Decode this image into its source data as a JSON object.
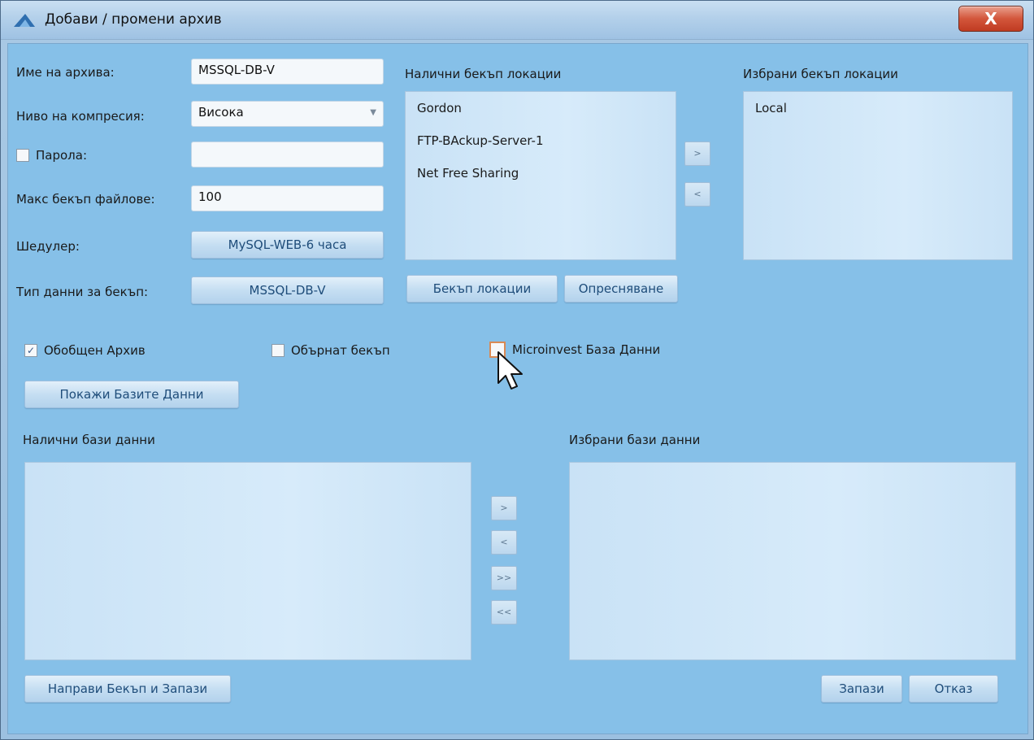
{
  "window": {
    "title": "Добави / промени архив",
    "close_label": "X"
  },
  "form": {
    "archive_name_label": "Име на архива:",
    "archive_name_value": "MSSQL-DB-V",
    "compression_label": "Ниво на компресия:",
    "compression_value": "Висока",
    "password_label": "Парола:",
    "password_value": "",
    "max_files_label": "Макс бекъп файлове:",
    "max_files_value": "100",
    "scheduler_label": "Шедулер:",
    "scheduler_button": "MySQL-WEB-6 часа",
    "data_type_label": "Тип данни за бекъп:",
    "data_type_button": "MSSQL-DB-V"
  },
  "locations": {
    "available_header": "Налични бекъп локации",
    "available": [
      "Gordon",
      "FTP-BAckup-Server-1",
      "Net Free Sharing"
    ],
    "selected_header": "Избрани бекъп локации",
    "selected": [
      "Local"
    ],
    "add_label": ">",
    "remove_label": "<",
    "backup_locations_button": "Бекъп локации",
    "refresh_button": "Опресняване"
  },
  "options": {
    "general_archive": {
      "label": "Обобщен Архив",
      "checked": true
    },
    "reverse_backup": {
      "label": "Обърнат бекъп",
      "checked": false
    },
    "microinvest_db": {
      "label": "Microinvest База Данни",
      "checked": false
    },
    "show_databases_button": "Покажи Базите Данни"
  },
  "databases": {
    "available_header": "Налични бази данни",
    "selected_header": "Избрани бази данни",
    "add_label": ">",
    "remove_label": "<",
    "add_all_label": ">>",
    "remove_all_label": "<<"
  },
  "footer": {
    "backup_and_save_button": "Направи Бекъп и Запази",
    "save_button": "Запази",
    "cancel_button": "Отказ"
  }
}
